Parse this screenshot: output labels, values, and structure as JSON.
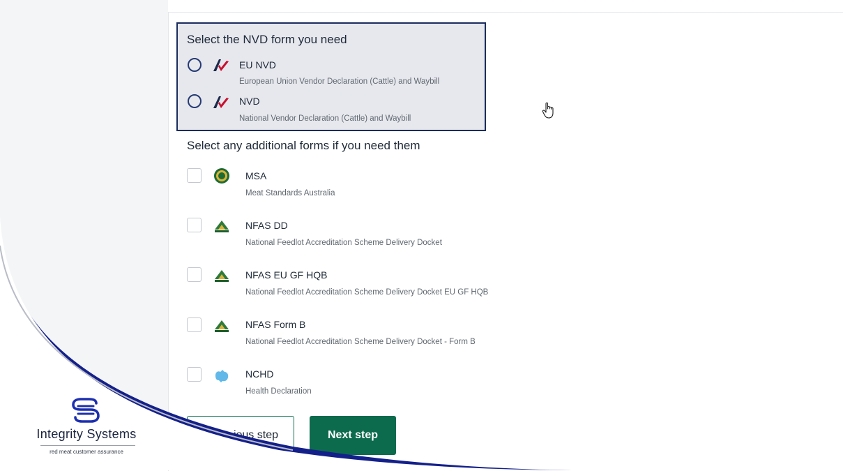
{
  "nvd_section": {
    "title": "Select the NVD form you need",
    "options": [
      {
        "name": "EU NVD",
        "description": "European Union Vendor Declaration (Cattle) and Waybill"
      },
      {
        "name": "NVD",
        "description": "National Vendor Declaration (Cattle) and Waybill"
      }
    ]
  },
  "additional_section": {
    "title": "Select any additional forms if you need them",
    "forms": [
      {
        "name": "MSA",
        "description": "Meat Standards Australia",
        "icon": "msa-logo-icon"
      },
      {
        "name": "NFAS DD",
        "description": "National Feedlot Accreditation Scheme Delivery Docket",
        "icon": "nfas-logo-icon"
      },
      {
        "name": "NFAS EU GF HQB",
        "description": "National Feedlot Accreditation Scheme Delivery Docket EU GF HQB",
        "icon": "nfas-logo-icon"
      },
      {
        "name": "NFAS Form B",
        "description": "National Feedlot Accreditation Scheme Delivery Docket - Form B",
        "icon": "nfas-logo-icon"
      },
      {
        "name": "NCHD",
        "description": "Health Declaration",
        "icon": "australia-map-icon"
      }
    ]
  },
  "buttons": {
    "previous_visible_text": "ious step",
    "next": "Next step"
  },
  "branding": {
    "name": "Integrity Systems",
    "tagline": "red meat customer assurance"
  },
  "colors": {
    "primary_green": "#0c6b4d",
    "navy": "#1b2c5e",
    "selection_bg": "#e7e8ee"
  }
}
